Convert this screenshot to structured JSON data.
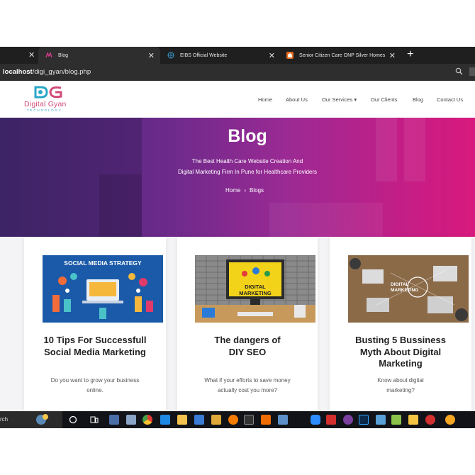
{
  "browser": {
    "tabs": [
      {
        "title": "Blog",
        "active": true
      },
      {
        "title": "EIBS Official Website",
        "active": false
      },
      {
        "title": "Senior Citizen Care ONP Silver Homes",
        "active": false
      }
    ],
    "close_glyph": "✕",
    "new_tab_glyph": "+",
    "url_host": "localhost",
    "url_path": "/digi_gyan/blog.php"
  },
  "site": {
    "logo_text": "Digital Gyan",
    "logo_sub": "TECHNOLOGY",
    "nav": [
      "Home",
      "About Us",
      "Our Services ▾",
      "Our Clients",
      "Blog",
      "Contact Us"
    ]
  },
  "hero": {
    "title": "Blog",
    "line1": "The Best Health Care Website Creation And",
    "line2": "Digital Marketing Firm In Pune for Healthcare Providers",
    "breadcrumb_home": "Home",
    "breadcrumb_sep": "›",
    "breadcrumb_current": "Blogs"
  },
  "cards": [
    {
      "image_heading": "SOCIAL MEDIA STRATEGY",
      "title": "10 Tips For Successfull Social Media Marketing",
      "desc": "Do you want to grow your business online."
    },
    {
      "image_heading": "DIGITAL MARKETING",
      "title": "The dangers of DIY SEO",
      "desc": "What if your efforts to save money actually cost you more?"
    },
    {
      "image_heading": "DIGITAL MARKETING",
      "title": "Busting 5 Bussiness Myth About Digital Marketing",
      "desc": "Know about digital marketing?"
    }
  ],
  "taskbar": {
    "search_text": "rch"
  },
  "colors": {
    "hero_start": "#4a2a73",
    "hero_end": "#d8197d",
    "logo_pink": "#d24a7a",
    "logo_teal": "#2aa6c8"
  }
}
